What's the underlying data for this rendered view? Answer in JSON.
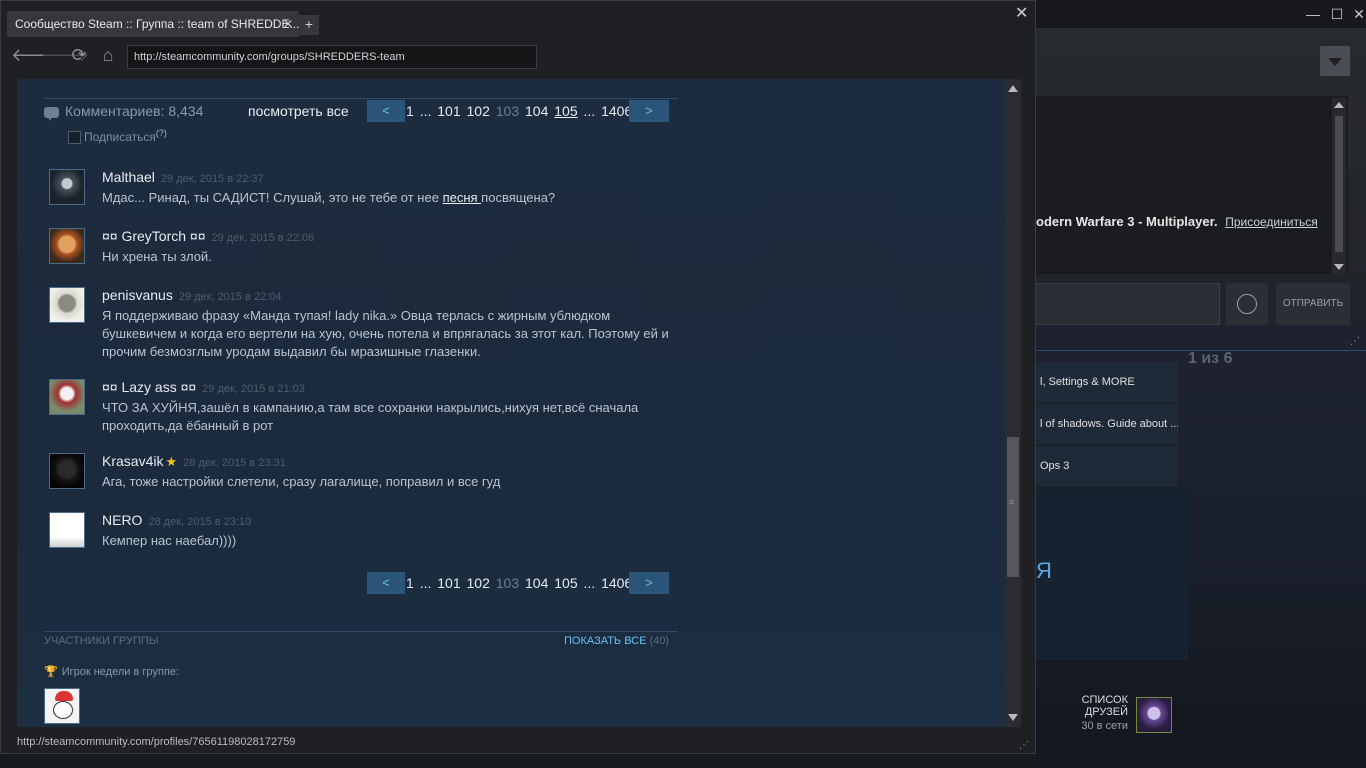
{
  "background_window": {
    "game_line": "odern Warfare 3 - Multiplayer.",
    "join_link": "Присоединиться",
    "send_label": "ОТПРАВИТЬ",
    "counter": "1 из 6",
    "guides": [
      "l, Settings & MORE",
      "l of shadows. Guide about ...",
      "Ops 3"
    ],
    "glyph": "Я",
    "friends_title": "СПИСОК ДРУЗЕЙ",
    "friends_online": "30 в сети",
    "controls": {
      "minimize": "—",
      "maximize": "☐",
      "close": "✕"
    }
  },
  "browser": {
    "tab_title": "Сообщество Steam :: Группа :: team of SHREDDE...",
    "tab_close": "✕",
    "new_tab": "+",
    "window_close": "✕",
    "url": "http://steamcommunity.com/groups/SHREDDERS-team",
    "status_url": "http://steamcommunity.com/profiles/76561198028172759"
  },
  "comments_header": {
    "count_label": "Комментариев: 8,434",
    "view_all": "посмотреть все",
    "subscribe": "Подписаться",
    "subscribe_help": "(?)"
  },
  "pager": {
    "prev": "<",
    "next": ">",
    "top_pages": [
      "1",
      "...",
      "101",
      "102",
      "103",
      "104",
      "105",
      "...",
      "1406"
    ],
    "bottom_pages": [
      "1",
      "...",
      "101",
      "102",
      "103",
      "104",
      "105",
      "...",
      "1406"
    ],
    "current": "103"
  },
  "comments": [
    {
      "author": "Malthael",
      "time": "29 дек, 2015 в 22:37",
      "text": "Мдас... Ринад, ты САДИСТ! Слушай, это не тебе от нее ",
      "link": "песня ",
      "text_after": "посвящена?"
    },
    {
      "author": "¤¤ GreyTorch ¤¤",
      "time": "29 дек, 2015 в 22:06",
      "text": "Ни хрена ты злой."
    },
    {
      "author": "penisvanus",
      "time": "29 дек, 2015 в 22:04",
      "text": "Я поддерживаю фразу «Манда тупая! lady nika.» Овца терлась с жирным ублюдком бушкевичем и когда его вертели на хую, очень потела и впрягалась за этот кал. Поэтому ей и прочим безмозглым уродам выдавил бы мразишные глазенки."
    },
    {
      "author": "¤¤ Lazy ass ¤¤",
      "time": "29 дек, 2015 в 21:03",
      "text": "ЧТО ЗА ХУЙНЯ,зашёл в кампанию,а там все сохранки накрылись,нихуя нет,всё сначала проходить,да ёбанный в рот"
    },
    {
      "author": "Krasav4ik",
      "star": "★",
      "time": "28 дек, 2015 в 23:31",
      "text": "Ага, тоже настройки слетели, сразу лагалище, поправил и все гуд"
    },
    {
      "author": "NERO",
      "time": "28 дек, 2015 в 23:10",
      "text": "Кемпер нас наебал))))"
    }
  ],
  "members": {
    "title": "УЧАСТНИКИ ГРУППЫ",
    "show_all": "ПОКАЗАТЬ ВСЕ",
    "count": "(40)",
    "player_week": "Игрок недели в группе:"
  },
  "colors": {
    "accent": "#66c0f4",
    "page_bg": "#1b2a3c",
    "pager_btn": "#2a5478"
  }
}
